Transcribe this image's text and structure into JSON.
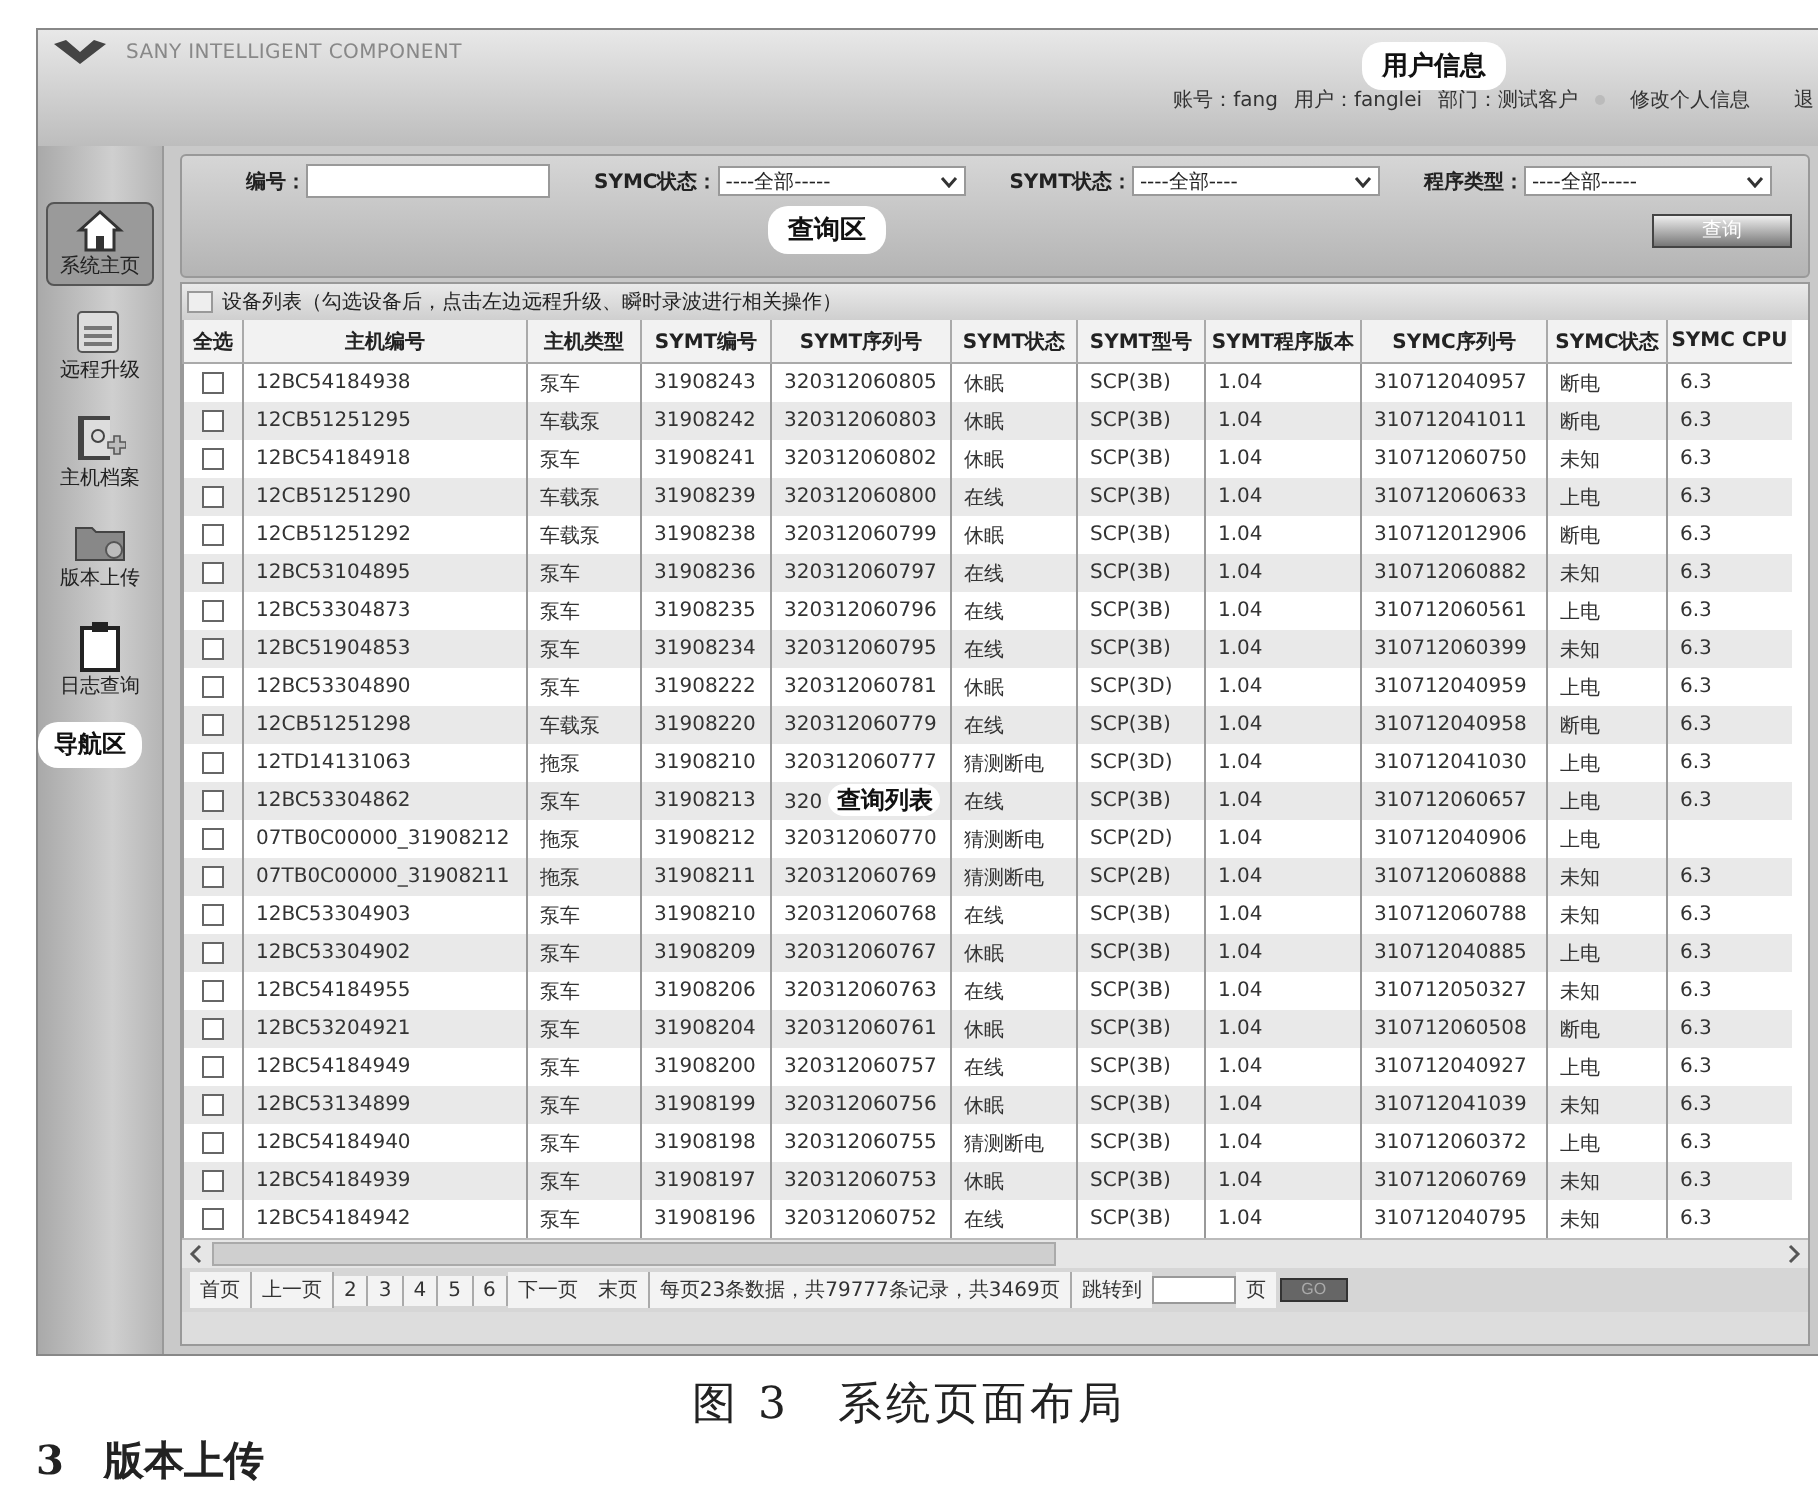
{
  "header": {
    "logo_text": "SANY INTELLIGENT COMPONENT",
    "annotation": "用户信息",
    "user_info": [
      "账号：fang",
      "用户：fanglei",
      "部门：测试客户"
    ],
    "links": [
      "修改个人信息",
      "退"
    ]
  },
  "sidebar": {
    "annotation": "导航区",
    "items": [
      {
        "kind": "home",
        "label": "系统主页",
        "selected": true
      },
      {
        "kind": "upgrade",
        "label": "远程升级",
        "selected": false
      },
      {
        "kind": "archive",
        "label": "主机档案",
        "selected": false
      },
      {
        "kind": "upload",
        "label": "版本上传",
        "selected": false
      },
      {
        "kind": "log",
        "label": "日志查询",
        "selected": false
      }
    ]
  },
  "query": {
    "annotation": "查询区",
    "button": "查询",
    "fields": [
      {
        "kind": "text",
        "label": "编号："
      },
      {
        "kind": "select",
        "label": "SYMC状态：",
        "value": "----全部-----"
      },
      {
        "kind": "select",
        "label": "SYMT状态：",
        "value": "----全部----"
      },
      {
        "kind": "select",
        "label": "程序类型：",
        "value": "----全部-----"
      }
    ]
  },
  "table": {
    "title": "设备列表（勾选设备后，点击左边远程升级、瞬时录波进行相关操作）",
    "select_column": "全选",
    "columns": [
      "主机编号",
      "主机类型",
      "SYMT编号",
      "SYMT序列号",
      "SYMT状态",
      "SYMT型号",
      "SYMT程序版本",
      "SYMC序列号",
      "SYMC状态",
      "SYMC CPU"
    ],
    "rows": [
      {
        "checked": false,
        "cells": [
          "12BC54184938",
          "泵车",
          "31908243",
          "320312060805",
          "休眠",
          "SCP(3B)",
          "1.04",
          "310712040957",
          "断电",
          "6.3"
        ]
      },
      {
        "checked": false,
        "cells": [
          "12CB51251295",
          "车载泵",
          "31908242",
          "320312060803",
          "休眠",
          "SCP(3B)",
          "1.04",
          "310712041011",
          "断电",
          "6.3"
        ]
      },
      {
        "checked": false,
        "cells": [
          "12BC54184918",
          "泵车",
          "31908241",
          "320312060802",
          "休眠",
          "SCP(3B)",
          "1.04",
          "310712060750",
          "未知",
          "6.3"
        ]
      },
      {
        "checked": false,
        "cells": [
          "12CB51251290",
          "车载泵",
          "31908239",
          "320312060800",
          "在线",
          "SCP(3B)",
          "1.04",
          "310712060633",
          "上电",
          "6.3"
        ]
      },
      {
        "checked": false,
        "cells": [
          "12CB51251292",
          "车载泵",
          "31908238",
          "320312060799",
          "休眠",
          "SCP(3B)",
          "1.04",
          "310712012906",
          "断电",
          "6.3"
        ]
      },
      {
        "checked": false,
        "cells": [
          "12BC53104895",
          "泵车",
          "31908236",
          "320312060797",
          "在线",
          "SCP(3B)",
          "1.04",
          "310712060882",
          "未知",
          "6.3"
        ]
      },
      {
        "checked": false,
        "cells": [
          "12BC53304873",
          "泵车",
          "31908235",
          "320312060796",
          "在线",
          "SCP(3B)",
          "1.04",
          "310712060561",
          "上电",
          "6.3"
        ]
      },
      {
        "checked": false,
        "cells": [
          "12BC51904853",
          "泵车",
          "31908234",
          "320312060795",
          "在线",
          "SCP(3B)",
          "1.04",
          "310712060399",
          "未知",
          "6.3"
        ]
      },
      {
        "checked": false,
        "cells": [
          "12BC53304890",
          "泵车",
          "31908222",
          "320312060781",
          "休眠",
          "SCP(3D)",
          "1.04",
          "310712040959",
          "上电",
          "6.3"
        ]
      },
      {
        "checked": false,
        "cells": [
          "12CB51251298",
          "车载泵",
          "31908220",
          "320312060779",
          "在线",
          "SCP(3B)",
          "1.04",
          "310712040958",
          "断电",
          "6.3"
        ]
      },
      {
        "checked": false,
        "cells": [
          "12TD14131063",
          "拖泵",
          "31908210",
          "320312060777",
          "猜测断电",
          "SCP(3D)",
          "1.04",
          "310712041030",
          "上电",
          "6.3"
        ]
      },
      {
        "checked": false,
        "annotation": "查询列表",
        "cells": [
          "12BC53304862",
          "泵车",
          "31908213",
          "320",
          "在线",
          "SCP(3B)",
          "1.04",
          "310712060657",
          "上电",
          "6.3"
        ]
      },
      {
        "checked": false,
        "cells": [
          "07TB0C00000_31908212",
          "拖泵",
          "31908212",
          "320312060770",
          "猜测断电",
          "SCP(2D)",
          "1.04",
          "310712040906",
          "上电"
        ]
      },
      {
        "checked": false,
        "cells": [
          "07TB0C00000_31908211",
          "拖泵",
          "31908211",
          "320312060769",
          "猜测断电",
          "SCP(2B)",
          "1.04",
          "310712060888",
          "未知",
          "6.3"
        ]
      },
      {
        "checked": false,
        "cells": [
          "12BC53304903",
          "泵车",
          "31908210",
          "320312060768",
          "在线",
          "SCP(3B)",
          "1.04",
          "310712060788",
          "未知",
          "6.3"
        ]
      },
      {
        "checked": false,
        "cells": [
          "12BC53304902",
          "泵车",
          "31908209",
          "320312060767",
          "休眠",
          "SCP(3B)",
          "1.04",
          "310712040885",
          "上电",
          "6.3"
        ]
      },
      {
        "checked": false,
        "cells": [
          "12BC54184955",
          "泵车",
          "31908206",
          "320312060763",
          "在线",
          "SCP(3B)",
          "1.04",
          "310712050327",
          "未知",
          "6.3"
        ]
      },
      {
        "checked": false,
        "cells": [
          "12BC53204921",
          "泵车",
          "31908204",
          "320312060761",
          "休眠",
          "SCP(3B)",
          "1.04",
          "310712060508",
          "断电",
          "6.3"
        ]
      },
      {
        "checked": false,
        "cells": [
          "12BC54184949",
          "泵车",
          "31908200",
          "320312060757",
          "在线",
          "SCP(3B)",
          "1.04",
          "310712040927",
          "上电",
          "6.3"
        ]
      },
      {
        "checked": false,
        "cells": [
          "12BC53134899",
          "泵车",
          "31908199",
          "320312060756",
          "休眠",
          "SCP(3B)",
          "1.04",
          "310712041039",
          "未知",
          "6.3"
        ]
      },
      {
        "checked": false,
        "cells": [
          "12BC54184940",
          "泵车",
          "31908198",
          "320312060755",
          "猜测断电",
          "SCP(3B)",
          "1.04",
          "310712060372",
          "上电",
          "6.3"
        ]
      },
      {
        "checked": false,
        "cells": [
          "12BC54184939",
          "泵车",
          "31908197",
          "320312060753",
          "休眠",
          "SCP(3B)",
          "1.04",
          "310712060769",
          "未知",
          "6.3"
        ]
      },
      {
        "checked": false,
        "cells": [
          "12BC54184942",
          "泵车",
          "31908196",
          "320312060752",
          "在线",
          "SCP(3B)",
          "1.04",
          "310712040795",
          "未知",
          "6.3"
        ]
      }
    ]
  },
  "pagination": {
    "first": "首页",
    "prev": "上一页",
    "pages": [
      "2",
      "3",
      "4",
      "5",
      "6"
    ],
    "next": "下一页",
    "last": "末页",
    "summary": "每页23条数据，共79777条记录，共3469页",
    "jump_label": "跳转到",
    "page_unit": "页",
    "go": "GO"
  },
  "caption": "图 3　系统页面布局",
  "next_heading": "3　版本上传"
}
